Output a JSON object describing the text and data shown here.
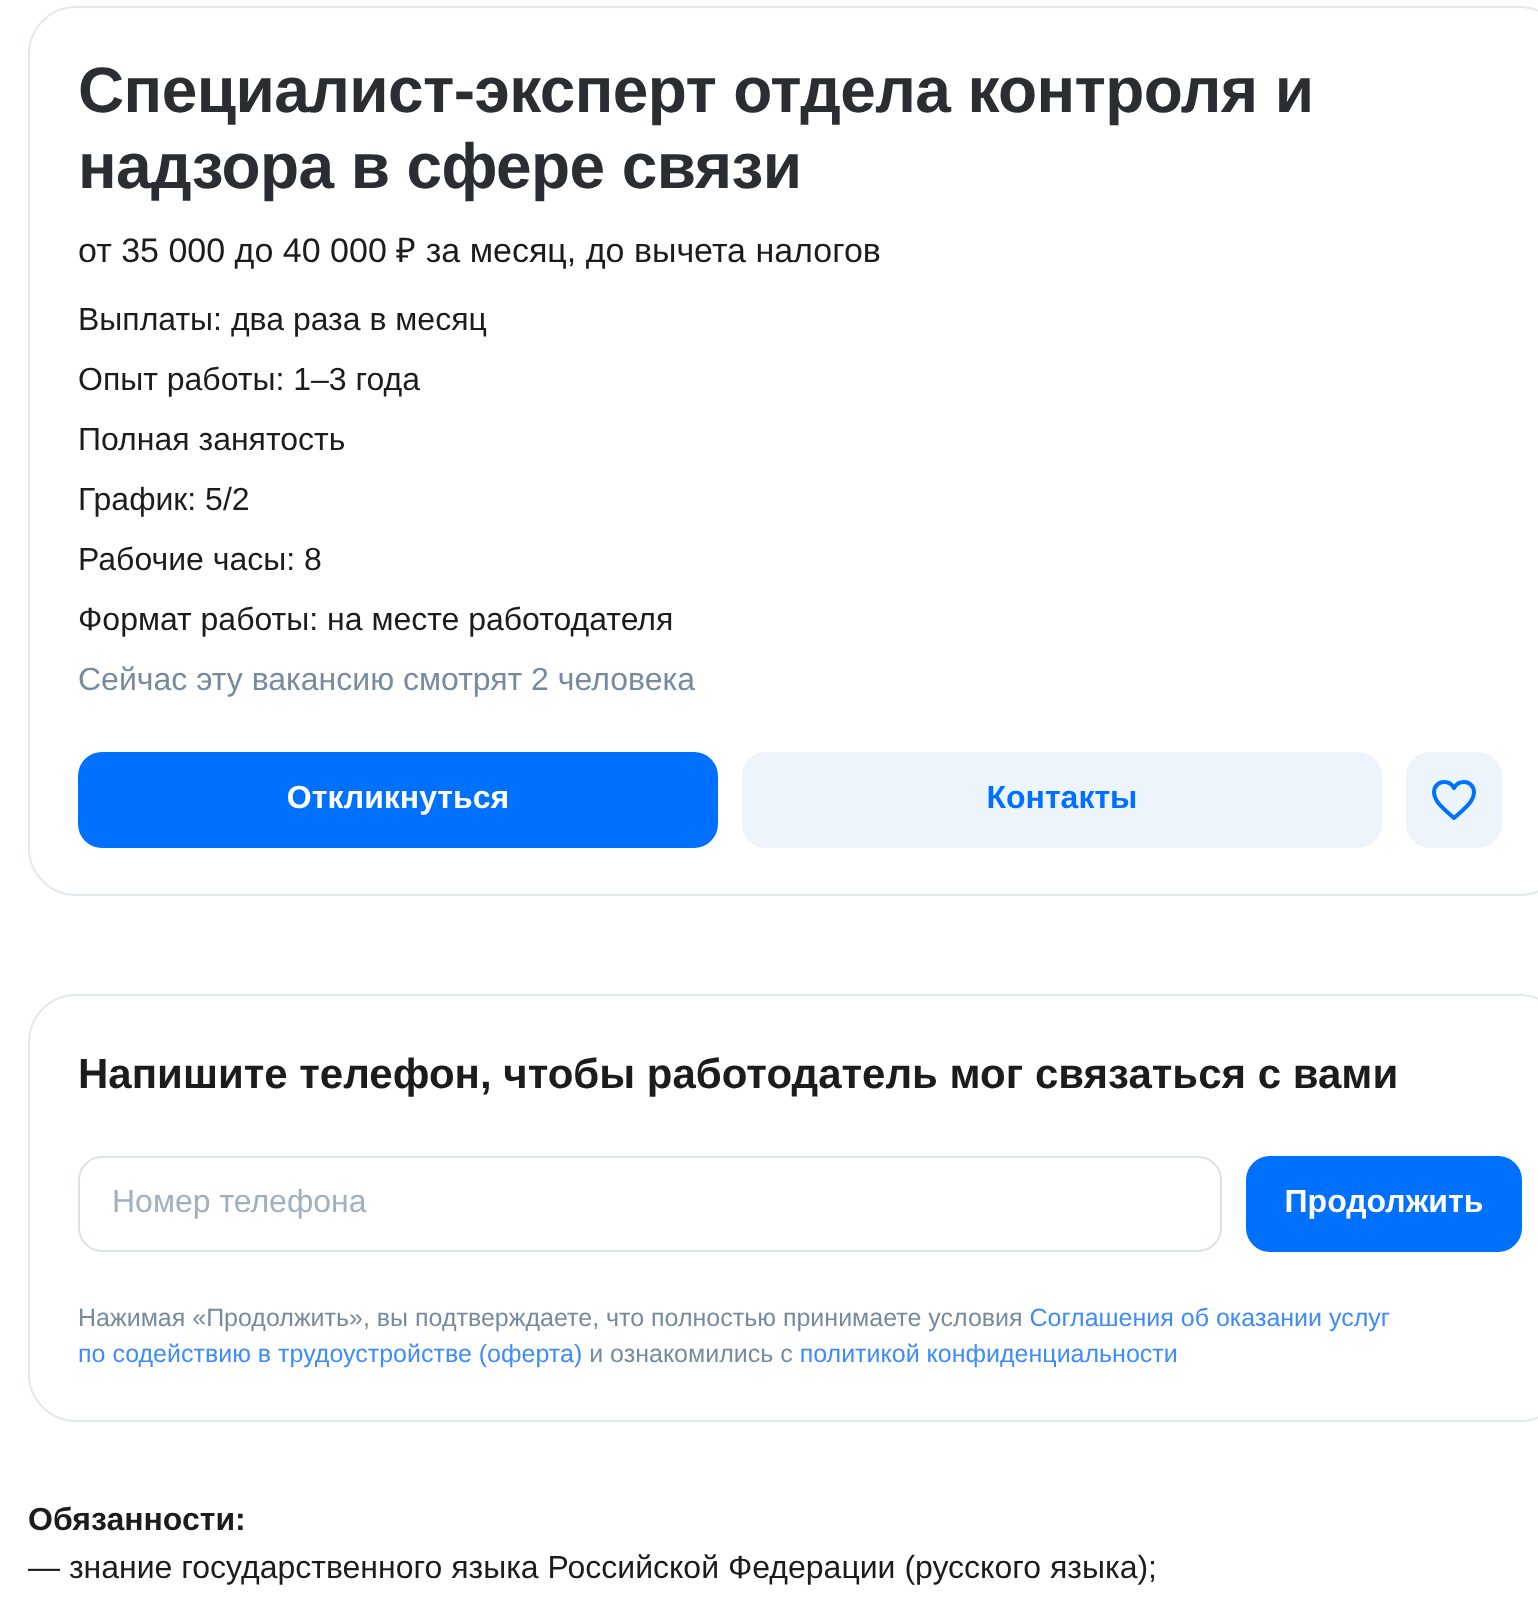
{
  "vacancy": {
    "title": "Специалист-эксперт отдела контроля и надзора в сфере связи",
    "salary": "от 35 000 до 40 000 ₽ за месяц, до вычета налогов",
    "details": [
      "Выплаты: два раза в месяц",
      "Опыт работы: 1–3 года",
      "Полная занятость",
      "График: 5/2",
      "Рабочие часы: 8",
      "Формат работы: на месте работодателя"
    ],
    "viewers": "Сейчас эту вакансию смотрят 2 человека",
    "buttons": [
      {
        "kind": "primary",
        "label": "Откликнуться"
      },
      {
        "kind": "secondary",
        "label": "Контакты"
      },
      {
        "kind": "favorite"
      }
    ]
  },
  "phone_form": {
    "title": "Напишите телефон, чтобы работодатель мог связаться с вами",
    "placeholder": "Номер телефона",
    "button": "Продолжить",
    "consent": [
      {
        "kind": "text",
        "text": "Нажимая «Продолжить», вы подтверждаете, что полностью принимаете условия "
      },
      {
        "kind": "link",
        "text": "Соглашения об оказании услуг"
      },
      {
        "kind": "link",
        "text": "по содействию в трудоустройстве (оферта)"
      },
      {
        "kind": "text",
        "text": " и ознакомились с "
      },
      {
        "kind": "link",
        "text": "политикой конфиденциальности"
      }
    ]
  },
  "description": {
    "heading": "Обязанности:",
    "items": [
      "— знание государственного языка Российской Федерации (русского языка);"
    ]
  }
}
